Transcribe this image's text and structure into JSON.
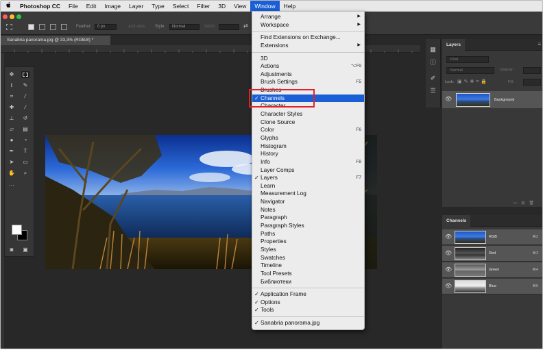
{
  "menubar": {
    "apple": "",
    "items": [
      "Photoshop CC",
      "File",
      "Edit",
      "Image",
      "Layer",
      "Type",
      "Select",
      "Filter",
      "3D",
      "View",
      "Window",
      "Help"
    ],
    "active_index": 10
  },
  "options_bar": {
    "feather_label": "Feather:",
    "feather_value": "0 px",
    "anti_alias_label": "Anti-alias",
    "style_label": "Style:",
    "style_value": "Normal",
    "width_label": "Width:"
  },
  "document": {
    "tab_title": "Sanabria panorama.jpg @ 33,3% (RGB/8) *"
  },
  "window_menu": {
    "items": [
      {
        "label": "Arrange",
        "submenu": true
      },
      {
        "label": "Workspace",
        "submenu": true
      },
      {
        "sep": true
      },
      {
        "label": "Find Extensions on Exchange..."
      },
      {
        "label": "Extensions",
        "submenu": true
      },
      {
        "sep": true
      },
      {
        "label": "3D"
      },
      {
        "label": "Actions",
        "shortcut": "⌥F9"
      },
      {
        "label": "Adjustments"
      },
      {
        "label": "Brush Settings",
        "shortcut": "F5"
      },
      {
        "label": "Brushes"
      },
      {
        "label": "Channels",
        "checked": true,
        "highlighted": true
      },
      {
        "label": "Character"
      },
      {
        "label": "Character Styles"
      },
      {
        "label": "Clone Source"
      },
      {
        "label": "Color",
        "shortcut": "F6"
      },
      {
        "label": "Glyphs"
      },
      {
        "label": "Histogram"
      },
      {
        "label": "History"
      },
      {
        "label": "Info",
        "shortcut": "F8"
      },
      {
        "label": "Layer Comps"
      },
      {
        "label": "Layers",
        "checked": true,
        "shortcut": "F7"
      },
      {
        "label": "Learn"
      },
      {
        "label": "Measurement Log"
      },
      {
        "label": "Navigator"
      },
      {
        "label": "Notes"
      },
      {
        "label": "Paragraph"
      },
      {
        "label": "Paragraph Styles"
      },
      {
        "label": "Paths"
      },
      {
        "label": "Properties"
      },
      {
        "label": "Styles"
      },
      {
        "label": "Swatches"
      },
      {
        "label": "Timeline"
      },
      {
        "label": "Tool Presets"
      },
      {
        "label": "Библиотеки"
      },
      {
        "sep": true
      },
      {
        "label": "Application Frame",
        "checked": true
      },
      {
        "label": "Options",
        "checked": true
      },
      {
        "label": "Tools",
        "checked": true
      },
      {
        "sep": true
      },
      {
        "label": "Sanabria panorama.jpg",
        "checked": true
      }
    ]
  },
  "layers_panel": {
    "title": "Layers",
    "kind_placeholder": "Kind",
    "blend_mode": "Normal",
    "opacity_label": "Opacity:",
    "lock_label": "Lock:",
    "fill_label": "Fill:",
    "layers": [
      {
        "name": "Background"
      }
    ]
  },
  "channels_panel": {
    "title": "Channels",
    "channels": [
      {
        "name": "RGB",
        "shortcut": "⌘2"
      },
      {
        "name": "Red",
        "shortcut": "⌘3"
      },
      {
        "name": "Green",
        "shortcut": "⌘4"
      },
      {
        "name": "Blue",
        "shortcut": "⌘5"
      }
    ]
  },
  "colors": {
    "menu_highlight": "#1a5fd6",
    "callout_border": "#e2222b",
    "ps_background": "#282828",
    "panel_background": "#383838"
  }
}
